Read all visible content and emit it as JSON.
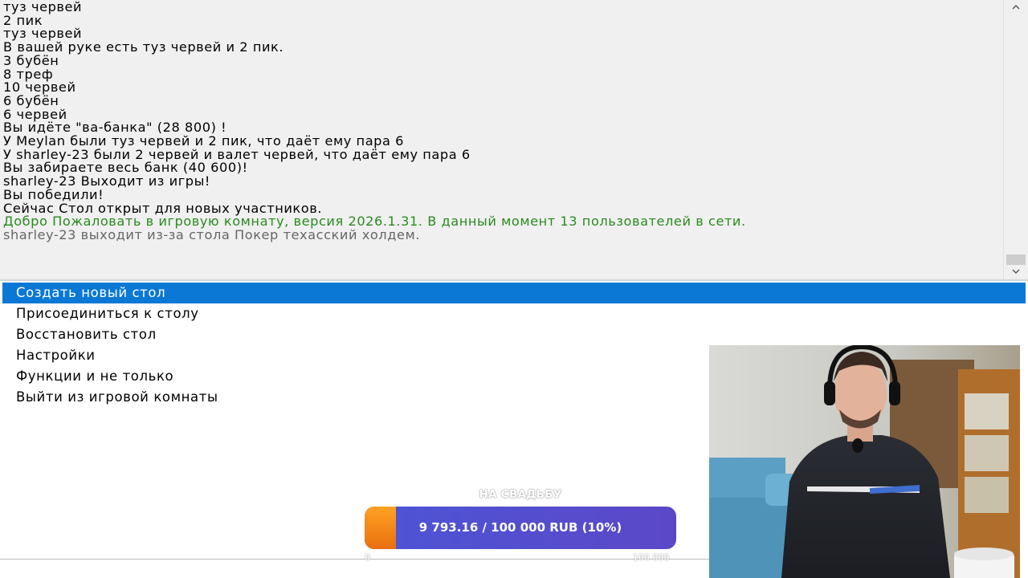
{
  "chat": {
    "lines": [
      {
        "text": "туз червей",
        "kind": "normal"
      },
      {
        "text": "2 пик",
        "kind": "normal"
      },
      {
        "text": "туз червей",
        "kind": "normal"
      },
      {
        "text": "В вашей руке есть туз червей и 2 пик.",
        "kind": "normal"
      },
      {
        "text": "3 бубён",
        "kind": "normal"
      },
      {
        "text": "8 треф",
        "kind": "normal"
      },
      {
        "text": "10 червей",
        "kind": "normal"
      },
      {
        "text": "6 бубён",
        "kind": "normal"
      },
      {
        "text": "6 червей",
        "kind": "normal"
      },
      {
        "text": "Вы идёте \"ва-банка\" (28 800) !",
        "kind": "normal"
      },
      {
        "text": "У Meylan были туз червей и 2 пик, что даёт ему пара 6",
        "kind": "normal"
      },
      {
        "text": "У sharley-23 были 2 червей и валет червей, что даёт ему пара 6",
        "kind": "normal"
      },
      {
        "text": "Вы забираете весь банк (40 600)!",
        "kind": "normal"
      },
      {
        "text": "sharley-23 Выходит из игры!",
        "kind": "normal"
      },
      {
        "text": "Вы победили!",
        "kind": "normal"
      },
      {
        "text": "Сейчас Стол открыт для новых участников.",
        "kind": "normal"
      },
      {
        "text": "Добро Пожаловать в игровую комнату, версия 2026.1.31. В данный момент 13 пользователей в сети.",
        "kind": "welcome"
      },
      {
        "text": "sharley-23 выходит из-за стола Покер техасский холдем.",
        "kind": "system"
      }
    ],
    "colors": {
      "text": "#000000",
      "welcome": "#2a8a1f",
      "system": "#666666"
    }
  },
  "menu": {
    "items": [
      {
        "label": "Создать новый стол",
        "selected": true
      },
      {
        "label": "Присоединиться к столу",
        "selected": false
      },
      {
        "label": "Восстановить стол",
        "selected": false
      },
      {
        "label": "Настройки",
        "selected": false
      },
      {
        "label": "Функции и не только",
        "selected": false
      },
      {
        "label": "Выйти из игровой комнаты",
        "selected": false
      }
    ],
    "selected_color": "#0a78d4"
  },
  "donation": {
    "title": "НА СВАДЬБУ",
    "progress_text": "9 793.16 / 100 000 RUB (10%)",
    "progress_fraction": 0.1,
    "min_label": "0",
    "max_label": "100 000"
  },
  "icons": {
    "scroll_up": "chevron-up-icon",
    "scroll_down": "chevron-down-icon"
  }
}
